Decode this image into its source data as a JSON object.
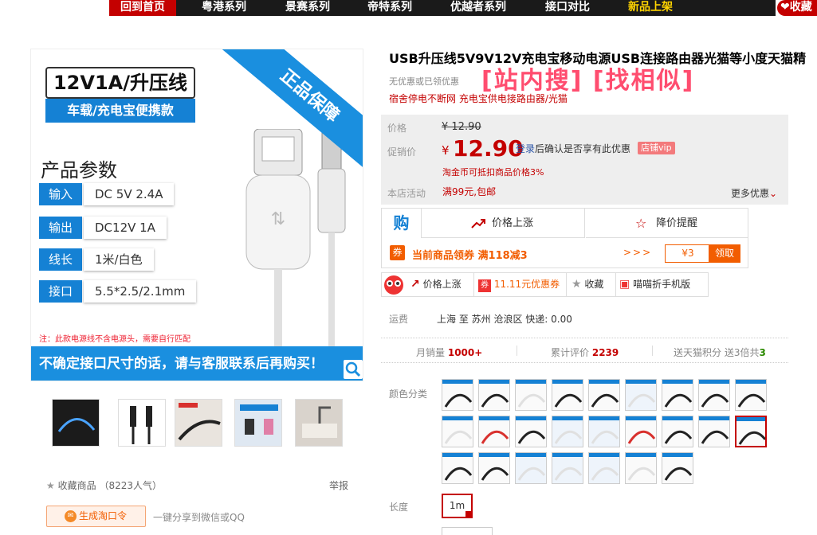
{
  "nav": {
    "home": "回到首页",
    "items": [
      "粤港系列",
      "景赛系列",
      "帝特系列",
      "优越者系列",
      "接口对比",
      "新品上架"
    ],
    "favorite": "收藏"
  },
  "main_image": {
    "ribbon": "正品保障",
    "headline": "12V1A/升压线",
    "subhead": "车载/充电宝便携款",
    "params_title": "产品参数",
    "params": [
      {
        "key": "输入",
        "value": "DC 5V 2.4A"
      },
      {
        "key": "输出",
        "value": "DC12V 1A"
      },
      {
        "key": "线长",
        "value": "1米/白色"
      },
      {
        "key": "接口",
        "value": "5.5*2.5/2.1mm"
      }
    ],
    "note": "注：此款电源线不含电源头，需要自行匹配",
    "banner": "不确定接口尺寸的话，请与客服联系后再购买！"
  },
  "thumbs": [
    {
      "name": "thumb-1",
      "color": "#1b1b1b"
    },
    {
      "name": "thumb-2",
      "color": "#ffffff"
    },
    {
      "name": "thumb-3",
      "color": "#e9e4de"
    },
    {
      "name": "thumb-4",
      "color": "#dfe8f2"
    },
    {
      "name": "thumb-5",
      "color": "#d9d3cc"
    }
  ],
  "left_actions": {
    "favorite": "收藏商品",
    "fav_count": "（8223人气）",
    "report": "举报",
    "generate": "生成淘口令",
    "share": "一键分享到微信或QQ"
  },
  "product": {
    "title": "USB升压线5V9V12V充电宝移动电源USB连接路由器光猫等小度天猫精",
    "no_discount": "无优惠或已领优惠",
    "search_links": "[站内搜]  [找相似]",
    "subtitle": "宿舍停电不断网 充电宝供电接路由器/光猫"
  },
  "price": {
    "price_label": "价格",
    "original": "¥ 12.90",
    "promo_label": "促销价",
    "currency": "¥",
    "current": "12.90",
    "login_link": "登录",
    "login_note": "后确认是否享有此优惠",
    "vip": "店铺vip",
    "taojin": "淘金币可抵扣商品价格3%",
    "activity_label": "本店活动",
    "activity": "满99元,包邮",
    "more": "更多优惠"
  },
  "gou": {
    "icon": "购",
    "rise": "价格上涨",
    "fall": "降价提醒",
    "coupon_icon": "券",
    "coupon_text": "当前商品领券  满118减3",
    "arrows": ">>>",
    "amount": "¥3",
    "get": "领取"
  },
  "tools": {
    "rise": "价格上涨",
    "coupon": "11.11元优惠券",
    "collect": "收藏",
    "mobile": "喵喵折手机版"
  },
  "shipping": {
    "label": "运费",
    "info": "上海  至 苏州 沧浪区  快递: 0.00"
  },
  "stats": {
    "monthly_label": "月销量",
    "monthly": "1000+",
    "reviews_label": "累计评价",
    "reviews": "2239",
    "points_label": "送天猫积分 送3倍共",
    "points": "3"
  },
  "options": {
    "color_label": "颜色分类",
    "length_label": "长度",
    "length_value": "1m"
  },
  "colors": {
    "accent": "#c40000",
    "orange": "#f25d00",
    "blue": "#1581d4"
  }
}
